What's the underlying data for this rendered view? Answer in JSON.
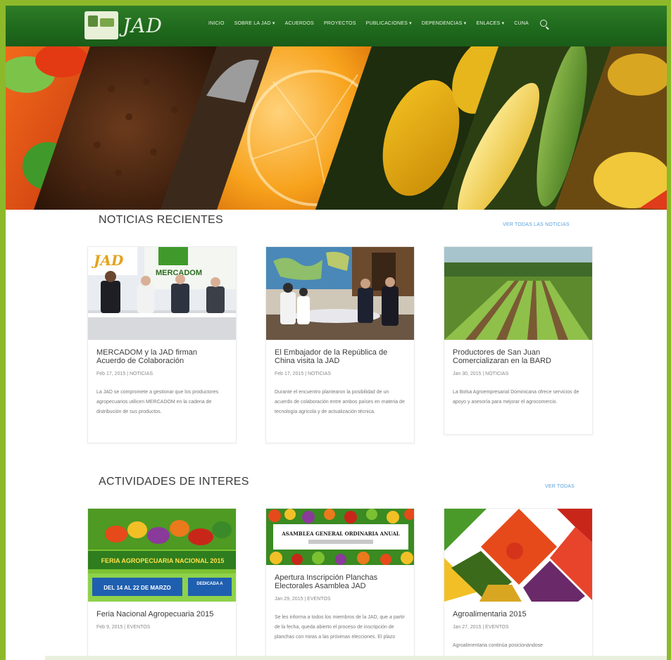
{
  "header": {
    "logo_text": "JAD",
    "nav": [
      "INICIO",
      "SOBRE LA JAD ▾",
      "ACUERDOS",
      "PROYECTOS",
      "PUBLICACIONES ▾",
      "DEPENDENCIAS ▾",
      "ENLACES ▾",
      "CUNA"
    ]
  },
  "hero": {
    "slides": 3,
    "active": 1
  },
  "news": {
    "title": "NOTICIAS RECIENTES",
    "see_all": "VER TODAS LAS NOTICIAS",
    "cards": [
      {
        "title": "MERCADOM y la JAD firman Acuerdo de Colaboración",
        "meta": "Feb 17, 2015 | NOTICIAS",
        "text": "La JAD se compromete a gestionar que los productores agropecuarios utilicen MERCADOM en la cadena de distribución de sus productos.",
        "banner_a": "JAD",
        "banner_b": "MERCADOM"
      },
      {
        "title": "El Embajador de la República de China visita la JAD",
        "meta": "Feb 17, 2015 | NOTICIAS",
        "text": "Durante el encuentro plantearon la posibilidad de un acuerdo de colaboración entre ambos países en materia de tecnología agrícola y de actualización técnica."
      },
      {
        "title": "Productores de San Juan Comercializaran en la BARD",
        "meta": "Jan 30, 2015 | NOTICIAS",
        "text": "La Bolsa Agroempresarial Dominicana ofrece servicios de apoyo y asesoría para mejorar el agrocomercio."
      }
    ]
  },
  "activities": {
    "title": "ACTIVIDADES DE INTERES",
    "see_all": "VER TODAS",
    "cards": [
      {
        "title": "Feria Nacional Agropecuaria 2015",
        "meta": "Feb 9, 2015 | EVENTOS",
        "text": "",
        "poster_title": "FERIA AGROPECUARIA NACIONAL 2015",
        "poster_dates": "DEL 14 AL 22 DE MARZO",
        "poster_side": "DEDICADA A"
      },
      {
        "title": "Apertura Inscripción Planchas Electorales Asamblea JAD",
        "meta": "Jan 29, 2015 | EVENTOS",
        "text": "Se les informa a todos los miembros de la JAD, que a partir de la fecha, queda abierto el proceso de inscripción de planchas con miras a las próximas elecciones. El plazo",
        "poster_title": "ASAMBLEA GENERAL ORDINARIA ANUAL"
      },
      {
        "title": "Agroalimentaria 2015",
        "meta": "Jan 27, 2015 | EVENTOS",
        "text": "Agroalimentaria continúa posicionándose"
      }
    ]
  },
  "colors": {
    "frame": "#8db82a",
    "header": "#1f6a1d",
    "link": "#5aa0d8"
  }
}
